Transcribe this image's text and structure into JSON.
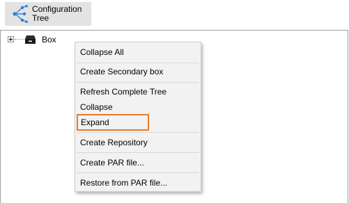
{
  "toolbar": {
    "configuration_tree_label_line1": "Configuration",
    "configuration_tree_label_line2": "Tree",
    "icon": "hierarchy-share-icon"
  },
  "tree": {
    "nodes": [
      {
        "label": "Box",
        "icon": "box-drawer-icon",
        "expander": "plus",
        "selected": false
      }
    ]
  },
  "context_menu": {
    "items": [
      {
        "label": "Collapse All"
      },
      {
        "label": "Create Secondary box"
      },
      {
        "label": "Refresh Complete Tree"
      },
      {
        "label": "Collapse"
      },
      {
        "label": "Expand",
        "highlighted": true
      },
      {
        "label": "Create Repository"
      },
      {
        "label": "Create PAR file..."
      },
      {
        "label": "Restore from PAR file..."
      }
    ],
    "highlight_color": "#e8792b"
  },
  "colors": {
    "toolbar_button_bg": "#e3e3e3",
    "icon_blue": "#2f7fd1",
    "menu_bg": "#f2f2f2"
  }
}
